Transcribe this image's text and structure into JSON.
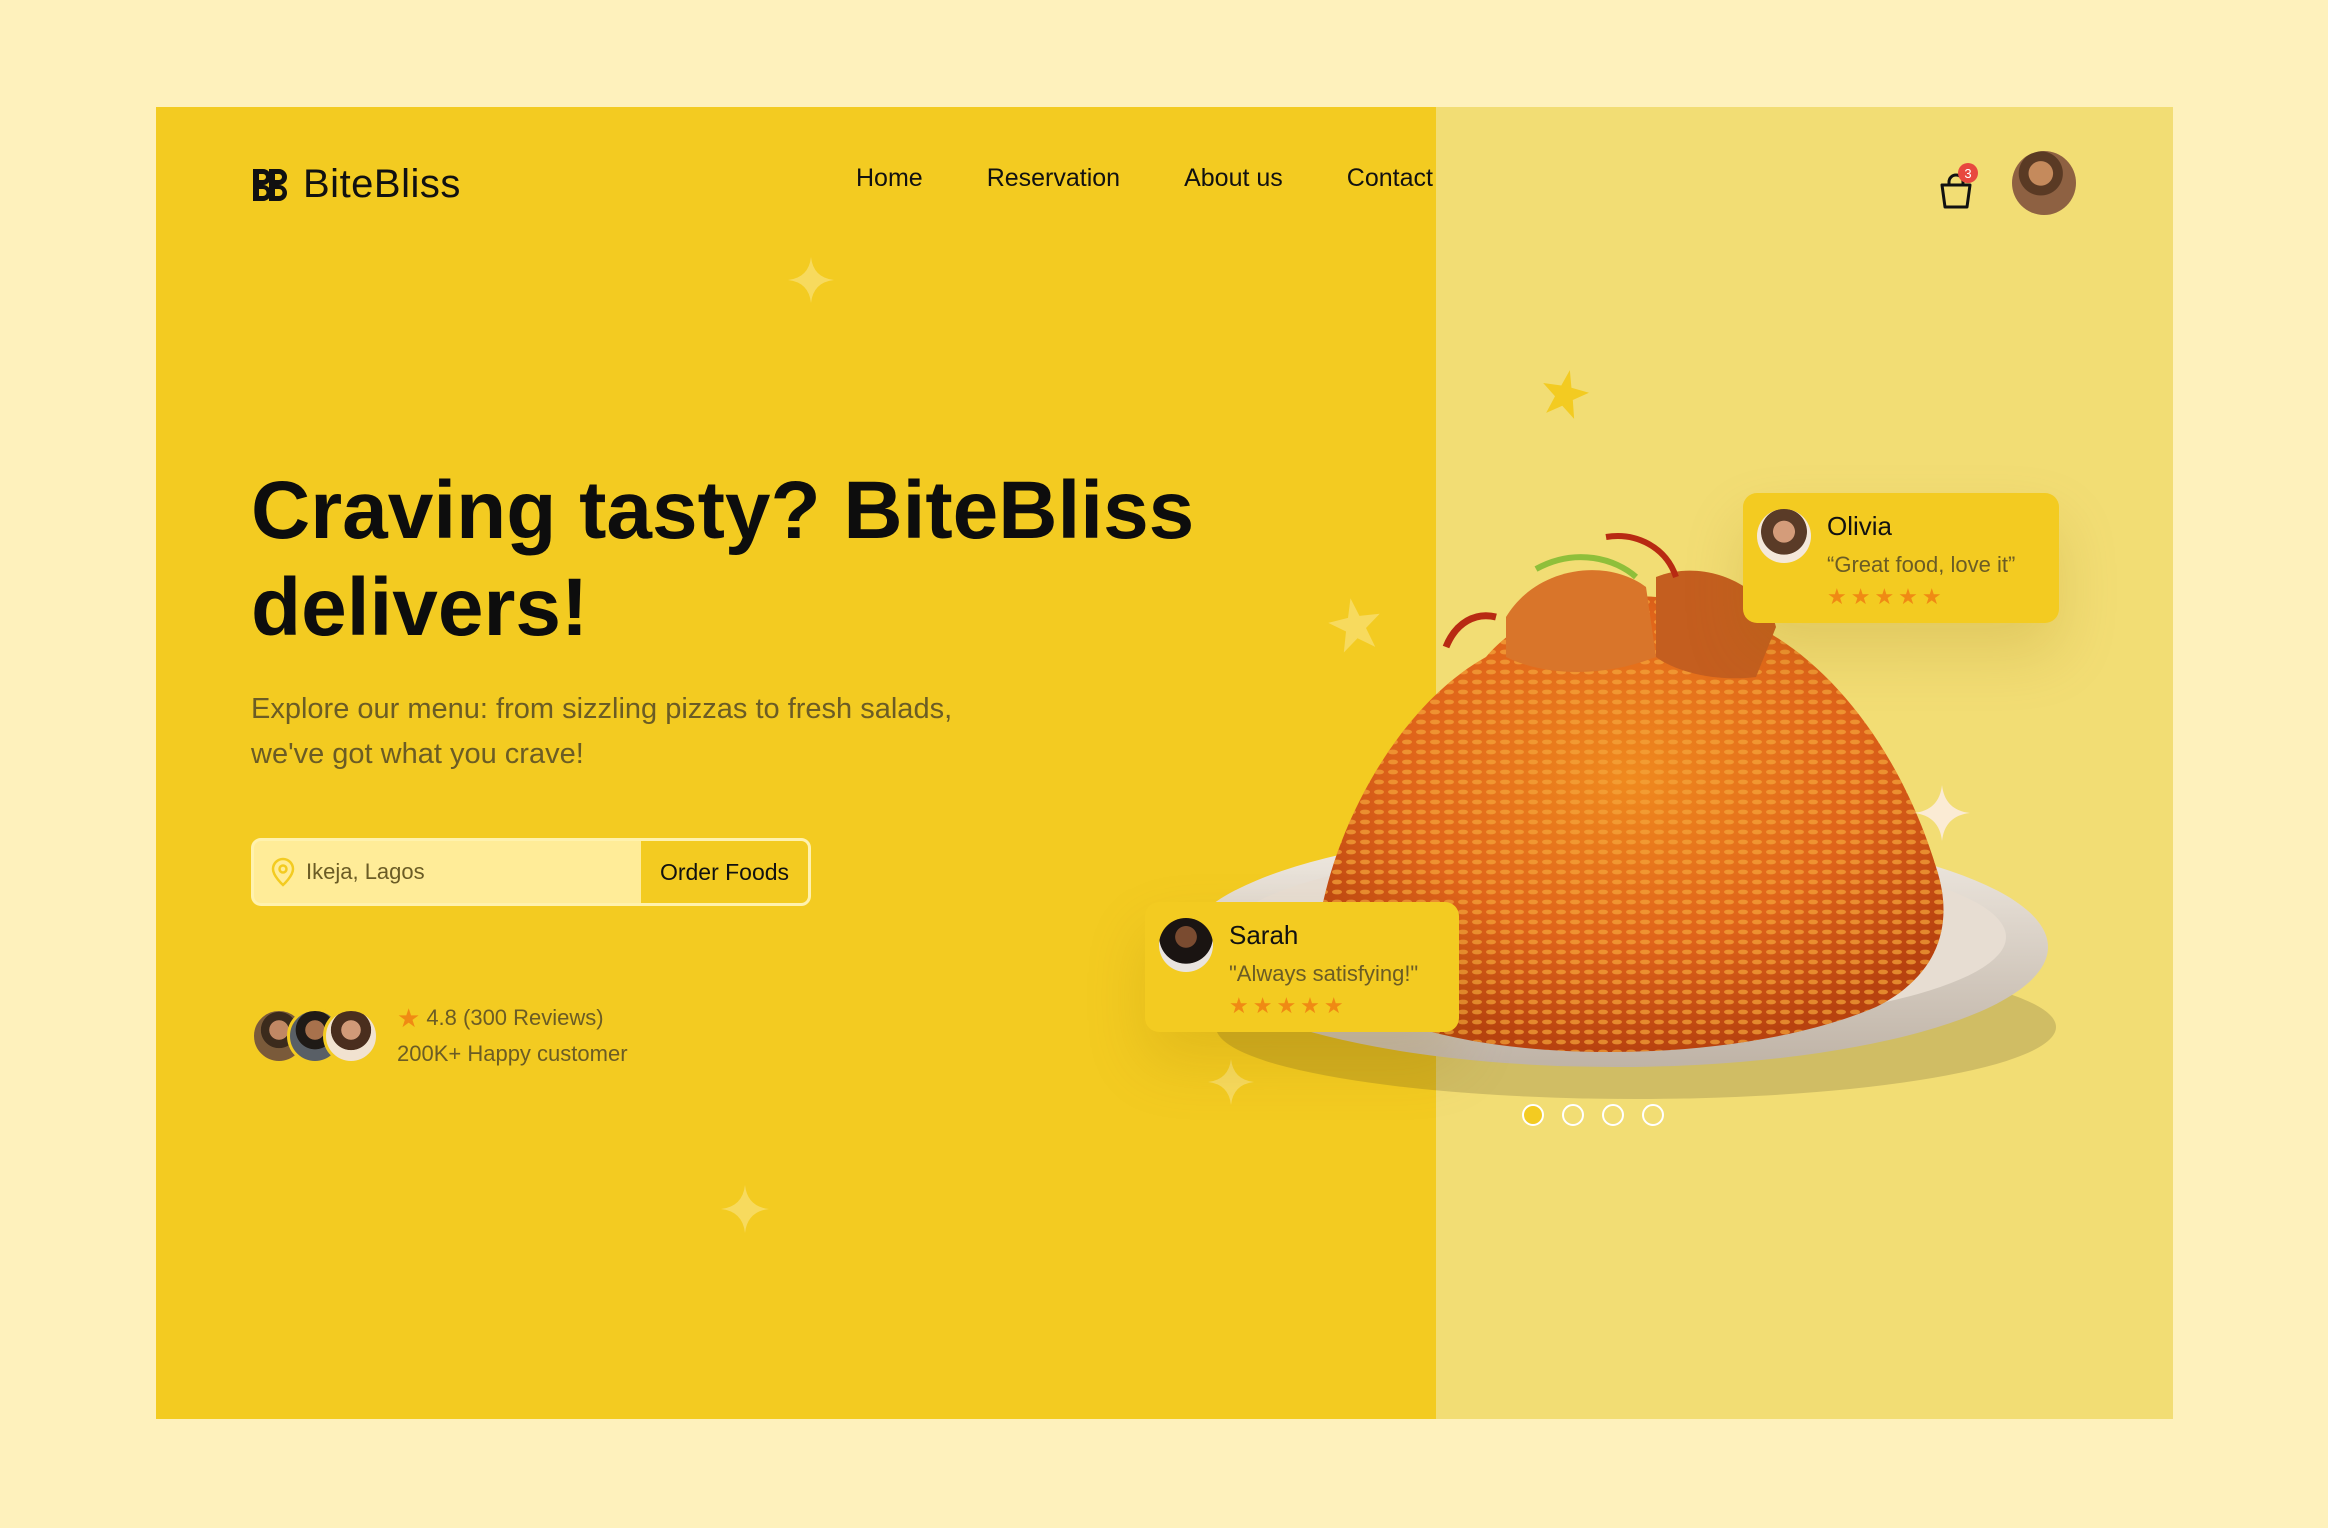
{
  "brand": {
    "name": "BiteBliss"
  },
  "nav": {
    "items": [
      "Home",
      "Reservation",
      "About us",
      "Contact"
    ]
  },
  "header": {
    "cart_count": "3"
  },
  "hero": {
    "headline_line1": "Craving tasty? BiteBliss",
    "headline_line2": "delivers!",
    "subtext_line1": "Explore our menu: from sizzling pizzas to fresh salads,",
    "subtext_line2": "we've got what you crave!",
    "location_value": "Ikeja, Lagos",
    "order_button": "Order Foods"
  },
  "social_proof": {
    "rating_text": "4.8 (300 Reviews)",
    "customers_text": "200K+ Happy customer"
  },
  "reviews": [
    {
      "name": "Olivia",
      "quote": "“Great food, love it”",
      "stars": 5
    },
    {
      "name": "Sarah",
      "quote": "\"Always satisfying!\"",
      "stars": 5
    }
  ],
  "carousel": {
    "total_slides": 4,
    "active_slide": 1
  },
  "colors": {
    "page_background": "#FEF1BC",
    "hero_yellow": "#F3CB21",
    "right_panel": "#F2DD74",
    "star_orange": "#F08A14",
    "badge_red": "#E8483F"
  },
  "icons": [
    "logo-mark-icon",
    "cart-icon",
    "location-pin-icon",
    "star-icon",
    "sparkle-icon"
  ]
}
